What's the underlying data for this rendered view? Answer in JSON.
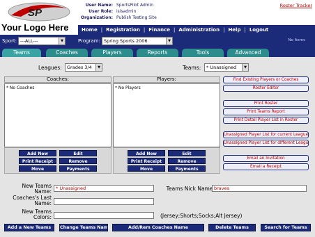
{
  "header": {
    "logo_text": "Your Logo Here",
    "user_name_label": "User Name:",
    "user_name": "SportsPilot Admin",
    "user_role_label": "User Role:",
    "user_role": "isisadmin",
    "organization_label": "Organization:",
    "organization": "Publish Testing Site",
    "roster_tracker": "Roster Tracker"
  },
  "topnav": {
    "items": [
      "Home",
      "Registration",
      "Finance",
      "Administration",
      "Help",
      "Logout"
    ],
    "separator": "|"
  },
  "filterbar": {
    "sport_label": "Sport:",
    "sport_value": "---ALL---",
    "program_label": "Program:",
    "program_value": "Spring Sports 2006",
    "status_text": "No Items"
  },
  "tabs": [
    "Teams",
    "Coaches",
    "Players",
    "Reports",
    "Tools",
    "Advanced"
  ],
  "filters": {
    "leagues_label": "Leagues:",
    "leagues_value": "Grades 3/4",
    "teams_label": "Teams:",
    "teams_value": "* Unassigned"
  },
  "coaches": {
    "header": "Coaches:",
    "empty_text": "* No Coaches",
    "buttons": [
      "Add New",
      "Edit",
      "Print Receipt",
      "Remove",
      "Move",
      "Payments"
    ]
  },
  "players": {
    "header": "Players:",
    "empty_text": "* No Players",
    "buttons": [
      "Add New",
      "Edit",
      "Print Receipt",
      "Remove",
      "Move",
      "Payments"
    ]
  },
  "side_buttons": [
    "Find Existing Players or Coaches",
    "Roster Editor",
    "Print Roster",
    "Print Teams Report",
    "Print Detail Player List in Roster",
    "Unassigned Player List for current League",
    "Unassigned Player List for different League",
    "Email an Invitation",
    "Email a Receipt"
  ],
  "form": {
    "new_team_name_label": "New Teams Name:",
    "new_team_name_value": "* Unassigned",
    "coach_last_name_label": "Coaches's Last Name:",
    "team_colors_label": "New Teams Colors:",
    "nick_name_label": "Teams Nick Name:",
    "nick_name_value": "braves",
    "uniform_hint": "(Jersey;Shorts;Socks;Alt Jersey)"
  },
  "bottom_buttons": [
    "Add a New Teams",
    "Change Teams Nam",
    "Add/Rem Coaches Name",
    "Delete Teams",
    "Search for Teams"
  ],
  "colors": {
    "navy": "#1c2a7a",
    "tab_teal": "#2d8c8c",
    "link_red": "#c00000",
    "panel_gray": "#e4e4e4"
  }
}
